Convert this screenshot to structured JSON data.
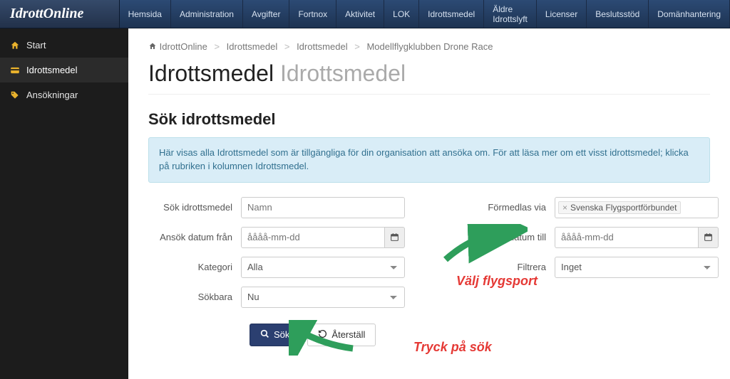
{
  "logo_text": "IdrottOnline",
  "nav": [
    "Hemsida",
    "Administration",
    "Avgifter",
    "Fortnox",
    "Aktivitet",
    "LOK",
    "Idrottsmedel",
    "Äldre Idrottslyft",
    "Licenser",
    "Beslutsstöd",
    "Domänhantering"
  ],
  "sidebar": {
    "items": [
      {
        "label": "Start"
      },
      {
        "label": "Idrottsmedel"
      },
      {
        "label": "Ansökningar"
      }
    ]
  },
  "breadcrumb": [
    "IdrottOnline",
    "Idrottsmedel",
    "Idrottsmedel",
    "Modellflygklubben Drone Race"
  ],
  "page_title": "Idrottsmedel",
  "page_subtitle": "Idrottsmedel",
  "section_title": "Sök idrottsmedel",
  "info_text": "Här visas alla Idrottsmedel som är tillgängliga för din organisation att ansöka om. För att läsa mer om ett visst idrottsmedel; klicka på rubriken i kolumnen Idrottsmedel.",
  "form": {
    "label_name": "Sök idrottsmedel",
    "ph_name": "Namn",
    "label_via": "Förmedlas via",
    "tag_via": "Svenska Flygsportförbundet",
    "label_from": "Ansök datum från",
    "ph_date": "åååå-mm-dd",
    "label_to": "Ansök datum till",
    "label_kategori": "Kategori",
    "val_kategori": "Alla",
    "label_filtrera": "Filtrera",
    "val_filtrera": "Inget",
    "label_sokbara": "Sökbara",
    "val_sokbara": "Nu"
  },
  "buttons": {
    "sok": "Sök",
    "aterstall": "Återställ"
  },
  "anno": {
    "flygsport": "Välj flygsport",
    "sok": "Tryck på sök"
  }
}
